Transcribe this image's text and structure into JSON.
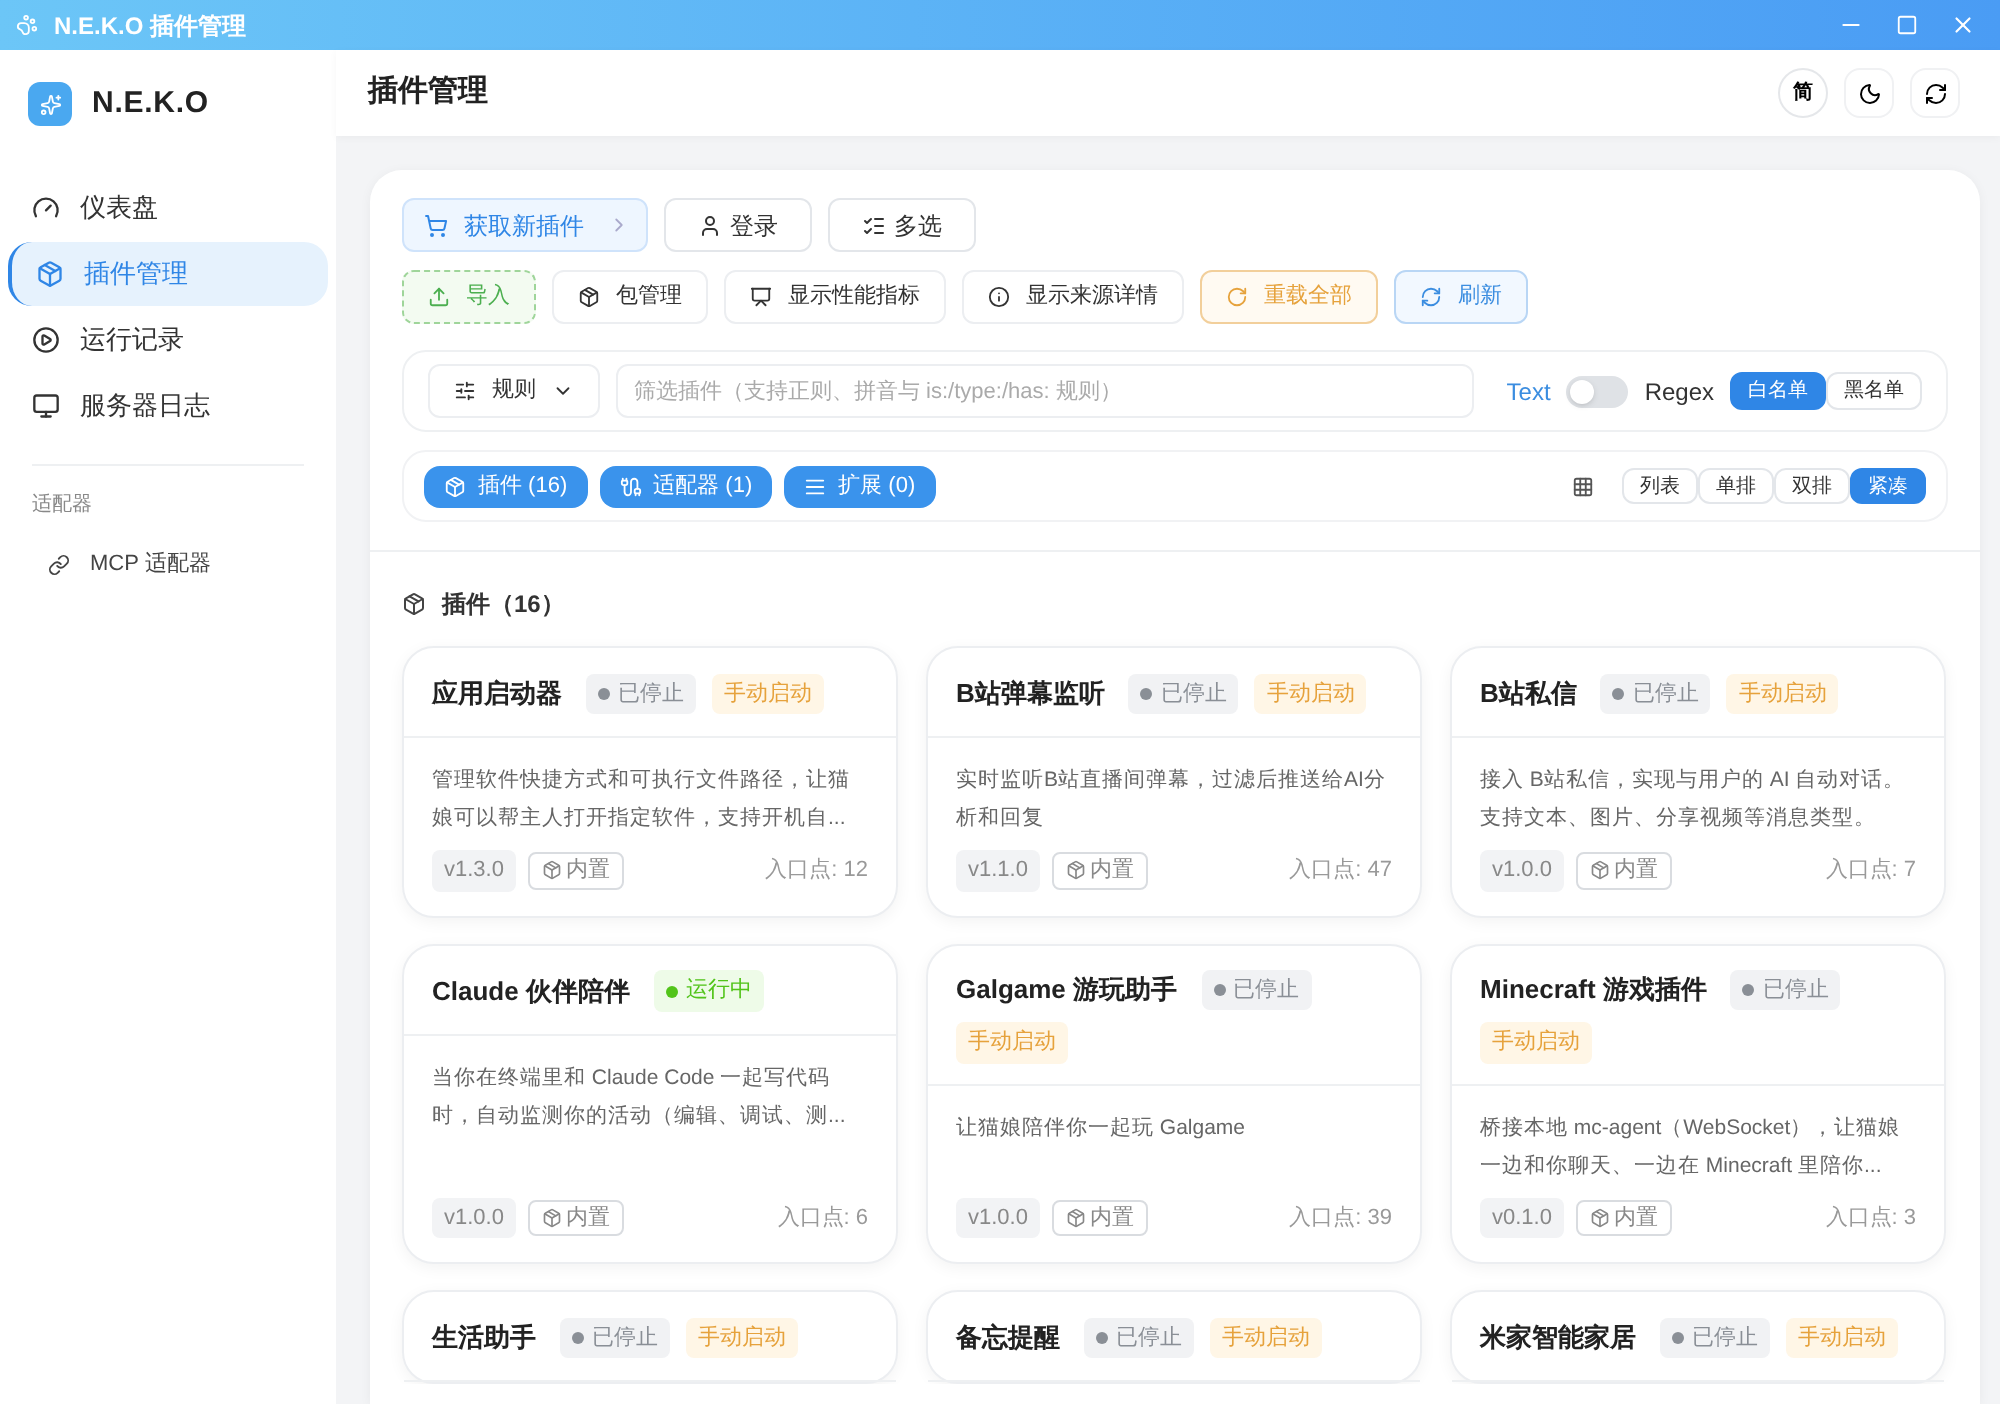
{
  "window": {
    "title": "N.E.K.O 插件管理"
  },
  "sidebar": {
    "brand": "N.E.K.O",
    "items": [
      {
        "label": "仪表盘",
        "selected": false
      },
      {
        "label": "插件管理",
        "selected": true
      },
      {
        "label": "运行记录",
        "selected": false
      },
      {
        "label": "服务器日志",
        "selected": false
      }
    ],
    "section": "适配器",
    "section_items": [
      {
        "label": "MCP 适配器",
        "selected": false
      }
    ]
  },
  "header": {
    "title": "插件管理",
    "language_button": "简"
  },
  "toolbar": {
    "row_1": [
      {
        "label": "获取新插件",
        "kind": "primary"
      },
      {
        "label": "登录",
        "kind": "default"
      },
      {
        "label": "多选",
        "kind": "default"
      }
    ],
    "row_2": [
      {
        "label": "导入",
        "kind": "success"
      },
      {
        "label": "包管理",
        "kind": "soft"
      },
      {
        "label": "显示性能指标",
        "kind": "soft"
      },
      {
        "label": "显示来源详情",
        "kind": "soft"
      },
      {
        "label": "重载全部",
        "kind": "warning"
      },
      {
        "label": "刷新",
        "kind": "info"
      }
    ]
  },
  "filter": {
    "rules_button": "规则",
    "placeholder": "筛选插件（支持正则、拼音与 is:/type:/has: 规则）",
    "text_label": "Text",
    "regex_on": false,
    "regex_label": "Regex",
    "modes": [
      {
        "label": "白名单",
        "selected": true
      },
      {
        "label": "黑名单",
        "selected": false
      }
    ]
  },
  "categories": [
    {
      "label": "插件 (16)",
      "selected": true
    },
    {
      "label": "适配器 (1)",
      "selected": true
    },
    {
      "label": "扩展 (0)",
      "selected": true
    }
  ],
  "layouts": [
    {
      "label": "列表",
      "selected": false
    },
    {
      "label": "单排",
      "selected": false
    },
    {
      "label": "双排",
      "selected": false
    },
    {
      "label": "紧凑",
      "selected": true
    }
  ],
  "section_title": "插件（16）",
  "plugins": [
    {
      "name": "应用启动器",
      "status": {
        "label": "已停止",
        "kind": "stopped"
      },
      "start_mode": "手动启动",
      "description": "管理软件快捷方式和可执行文件路径，让猫娘可以帮主人打开指定软件，支持开机自...",
      "version": "v1.3.0",
      "tag": "内置",
      "entry": "入口点: 12"
    },
    {
      "name": "B站弹幕监听",
      "status": {
        "label": "已停止",
        "kind": "stopped"
      },
      "start_mode": "手动启动",
      "description": "实时监听B站直播间弹幕，过滤后推送给AI分析和回复",
      "version": "v1.1.0",
      "tag": "内置",
      "entry": "入口点: 47"
    },
    {
      "name": "B站私信",
      "status": {
        "label": "已停止",
        "kind": "stopped"
      },
      "start_mode": "手动启动",
      "description": "接入 B站私信，实现与用户的 AI 自动对话。支持文本、图片、分享视频等消息类型。",
      "version": "v1.0.0",
      "tag": "内置",
      "entry": "入口点: 7"
    },
    {
      "name": "Claude 伙伴陪伴",
      "status": {
        "label": "运行中",
        "kind": "running"
      },
      "description": "当你在终端里和 Claude Code 一起写代码时，自动监测你的活动（编辑、调试、测...",
      "version": "v1.0.0",
      "tag": "内置",
      "entry": "入口点: 6"
    },
    {
      "name": "Galgame 游玩助手",
      "status": {
        "label": "已停止",
        "kind": "stopped"
      },
      "start_mode": "手动启动",
      "description": "让猫娘陪伴你一起玩 Galgame",
      "version": "v1.0.0",
      "tag": "内置",
      "entry": "入口点: 39"
    },
    {
      "name": "Minecraft 游戏插件",
      "status": {
        "label": "已停止",
        "kind": "stopped"
      },
      "start_mode": "手动启动",
      "description": "桥接本地 mc-agent（WebSocket），让猫娘一边和你聊天、一边在 Minecraft 里陪你...",
      "version": "v0.1.0",
      "tag": "内置",
      "entry": "入口点: 3"
    },
    {
      "name": "生活助手",
      "status": {
        "label": "已停止",
        "kind": "stopped"
      },
      "start_mode": "手动启动"
    },
    {
      "name": "备忘提醒",
      "status": {
        "label": "已停止",
        "kind": "stopped"
      },
      "start_mode": "手动启动"
    },
    {
      "name": "米家智能家居",
      "status": {
        "label": "已停止",
        "kind": "stopped"
      },
      "start_mode": "手动启动"
    }
  ]
}
